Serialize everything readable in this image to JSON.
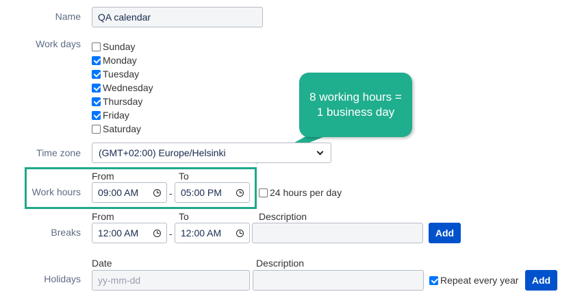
{
  "form": {
    "name_label": "Name",
    "name_value": "QA calendar",
    "workdays_label": "Work days",
    "days": [
      {
        "label": "Sunday",
        "checked": false
      },
      {
        "label": "Monday",
        "checked": true
      },
      {
        "label": "Tuesday",
        "checked": true
      },
      {
        "label": "Wednesday",
        "checked": true
      },
      {
        "label": "Thursday",
        "checked": true
      },
      {
        "label": "Friday",
        "checked": true
      },
      {
        "label": "Saturday",
        "checked": false
      }
    ],
    "timezone_label": "Time zone",
    "timezone_value": "(GMT+02:00) Europe/Helsinki",
    "work_hours": {
      "label": "Work hours",
      "from_label": "From",
      "to_label": "To",
      "from_value": "09:00 AM",
      "to_value": "05:00 PM",
      "dash": "-",
      "all_day_label": "24 hours per day",
      "all_day_checked": false
    },
    "breaks": {
      "label": "Breaks",
      "from_label": "From",
      "to_label": "To",
      "description_label": "Description",
      "from_value": "12:00 AM",
      "to_value": "12:00 AM",
      "dash": "-",
      "add_label": "Add"
    },
    "holidays": {
      "label": "Holidays",
      "date_label": "Date",
      "description_label": "Description",
      "date_placeholder": "yy-mm-dd",
      "repeat_label": "Repeat every year",
      "repeat_checked": true,
      "add_label": "Add"
    }
  },
  "callout": {
    "text": "8 working hours = 1 business day"
  },
  "colors": {
    "accent": "#1fae8e",
    "primary_button": "#0052cc",
    "checkbox": "#0075ff"
  }
}
